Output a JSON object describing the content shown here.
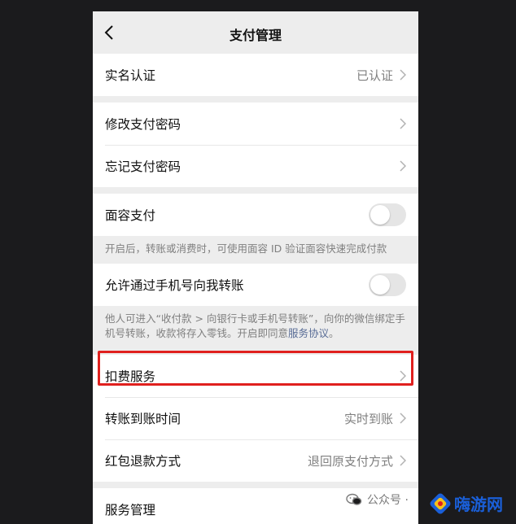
{
  "nav": {
    "title": "支付管理"
  },
  "rows": {
    "realname": {
      "label": "实名认证",
      "value": "已认证"
    },
    "change_password": {
      "label": "修改支付密码"
    },
    "forgot_password": {
      "label": "忘记支付密码"
    },
    "face_pay": {
      "label": "面容支付",
      "enabled": false,
      "note": "开启后，转账或消费时，可使用面容 ID 验证面容快速完成付款"
    },
    "phone_transfer": {
      "label": "允许通过手机号向我转账",
      "enabled": false,
      "note_text": "他人可进入“收付款 > 向银行卡或手机号转账”，向你的微信绑定手机号转账，收款将存入零钱。开启即同意",
      "note_link": "服务协议",
      "note_end": "。"
    },
    "deduction": {
      "label": "扣费服务"
    },
    "arrival_time": {
      "label": "转账到账时间",
      "value": "实时到账"
    },
    "refund_method": {
      "label": "红包退款方式",
      "value": "退回原支付方式"
    },
    "service_manage": {
      "label": "服务管理"
    }
  },
  "watermark": {
    "text": "公众号 ·"
  },
  "brand": {
    "name": "嗨游网"
  },
  "colors": {
    "highlight": "#e0201e",
    "link": "#576b95",
    "brand": "#1a5fd8"
  }
}
